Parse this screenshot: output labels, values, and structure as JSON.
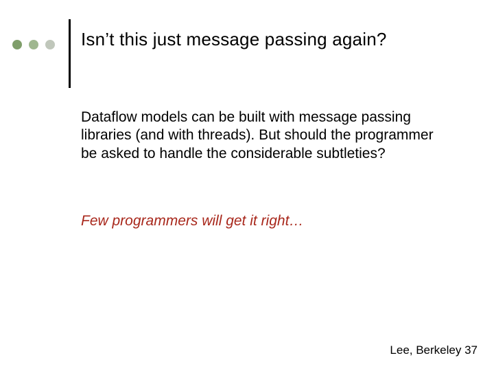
{
  "slide": {
    "title": "Isn’t this just message passing again?",
    "paragraph1": "Dataflow models can be built with message passing libraries (and with threads). But should the programmer be asked to handle the considerable subtleties?",
    "paragraph2": "Few programmers will get it right…",
    "footer": "Lee, Berkeley 37"
  },
  "decor": {
    "dot_colors": [
      "#7f9e6a",
      "#9fb78f",
      "#c0c7bb"
    ]
  }
}
